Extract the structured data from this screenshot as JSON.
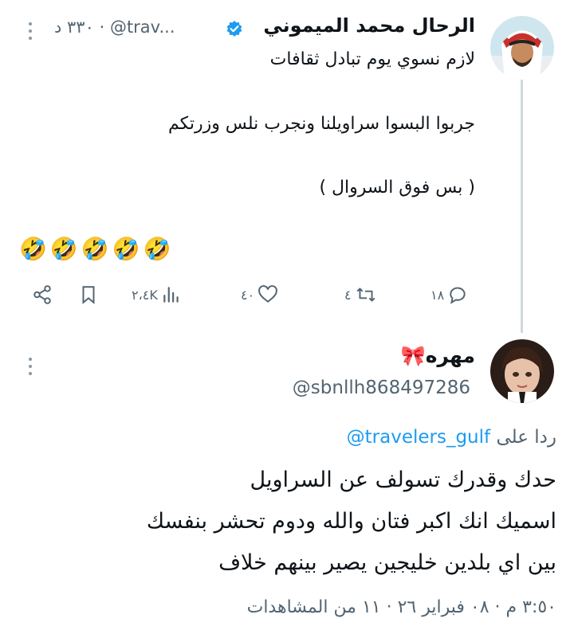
{
  "tweet": {
    "display_name": "الرحال محمد الميموني",
    "verified_icon": "verified-badge-icon",
    "handle": "@trav...",
    "time": "٣٣٠ د",
    "text_lines": [
      "لازم نسوي يوم تبادل ثقافات",
      "جربوا البسوا سراويلنا ونجرب نلس وزرتكم",
      "( بس فوق السروال )"
    ],
    "emojis": "🤣🤣🤣🤣🤣",
    "actions": {
      "replies": "١٨",
      "reposts": "٤",
      "likes": "٤٠",
      "views": "٢،٤K"
    }
  },
  "reply": {
    "display_name": "مهره🎀",
    "handle": "@sbnllh868497286",
    "replying_to_prefix": "ردا على",
    "replying_to_handle": "@travelers_gulf",
    "text_lines": [
      "حدك وقدرك تسولف عن السراويل",
      "اسميك انك اكبر فتان والله ودوم تحشر بنفسك",
      "بين اي بلدين خليجين يصير بينهم خلاف"
    ],
    "footer": "٣:٥٠ م · ٠٨ فبراير ٢٦ · ١١ من المشاهدات"
  },
  "colors": {
    "link": "#1d9bf0",
    "muted": "#536471",
    "verified": "#1d9bf0"
  }
}
